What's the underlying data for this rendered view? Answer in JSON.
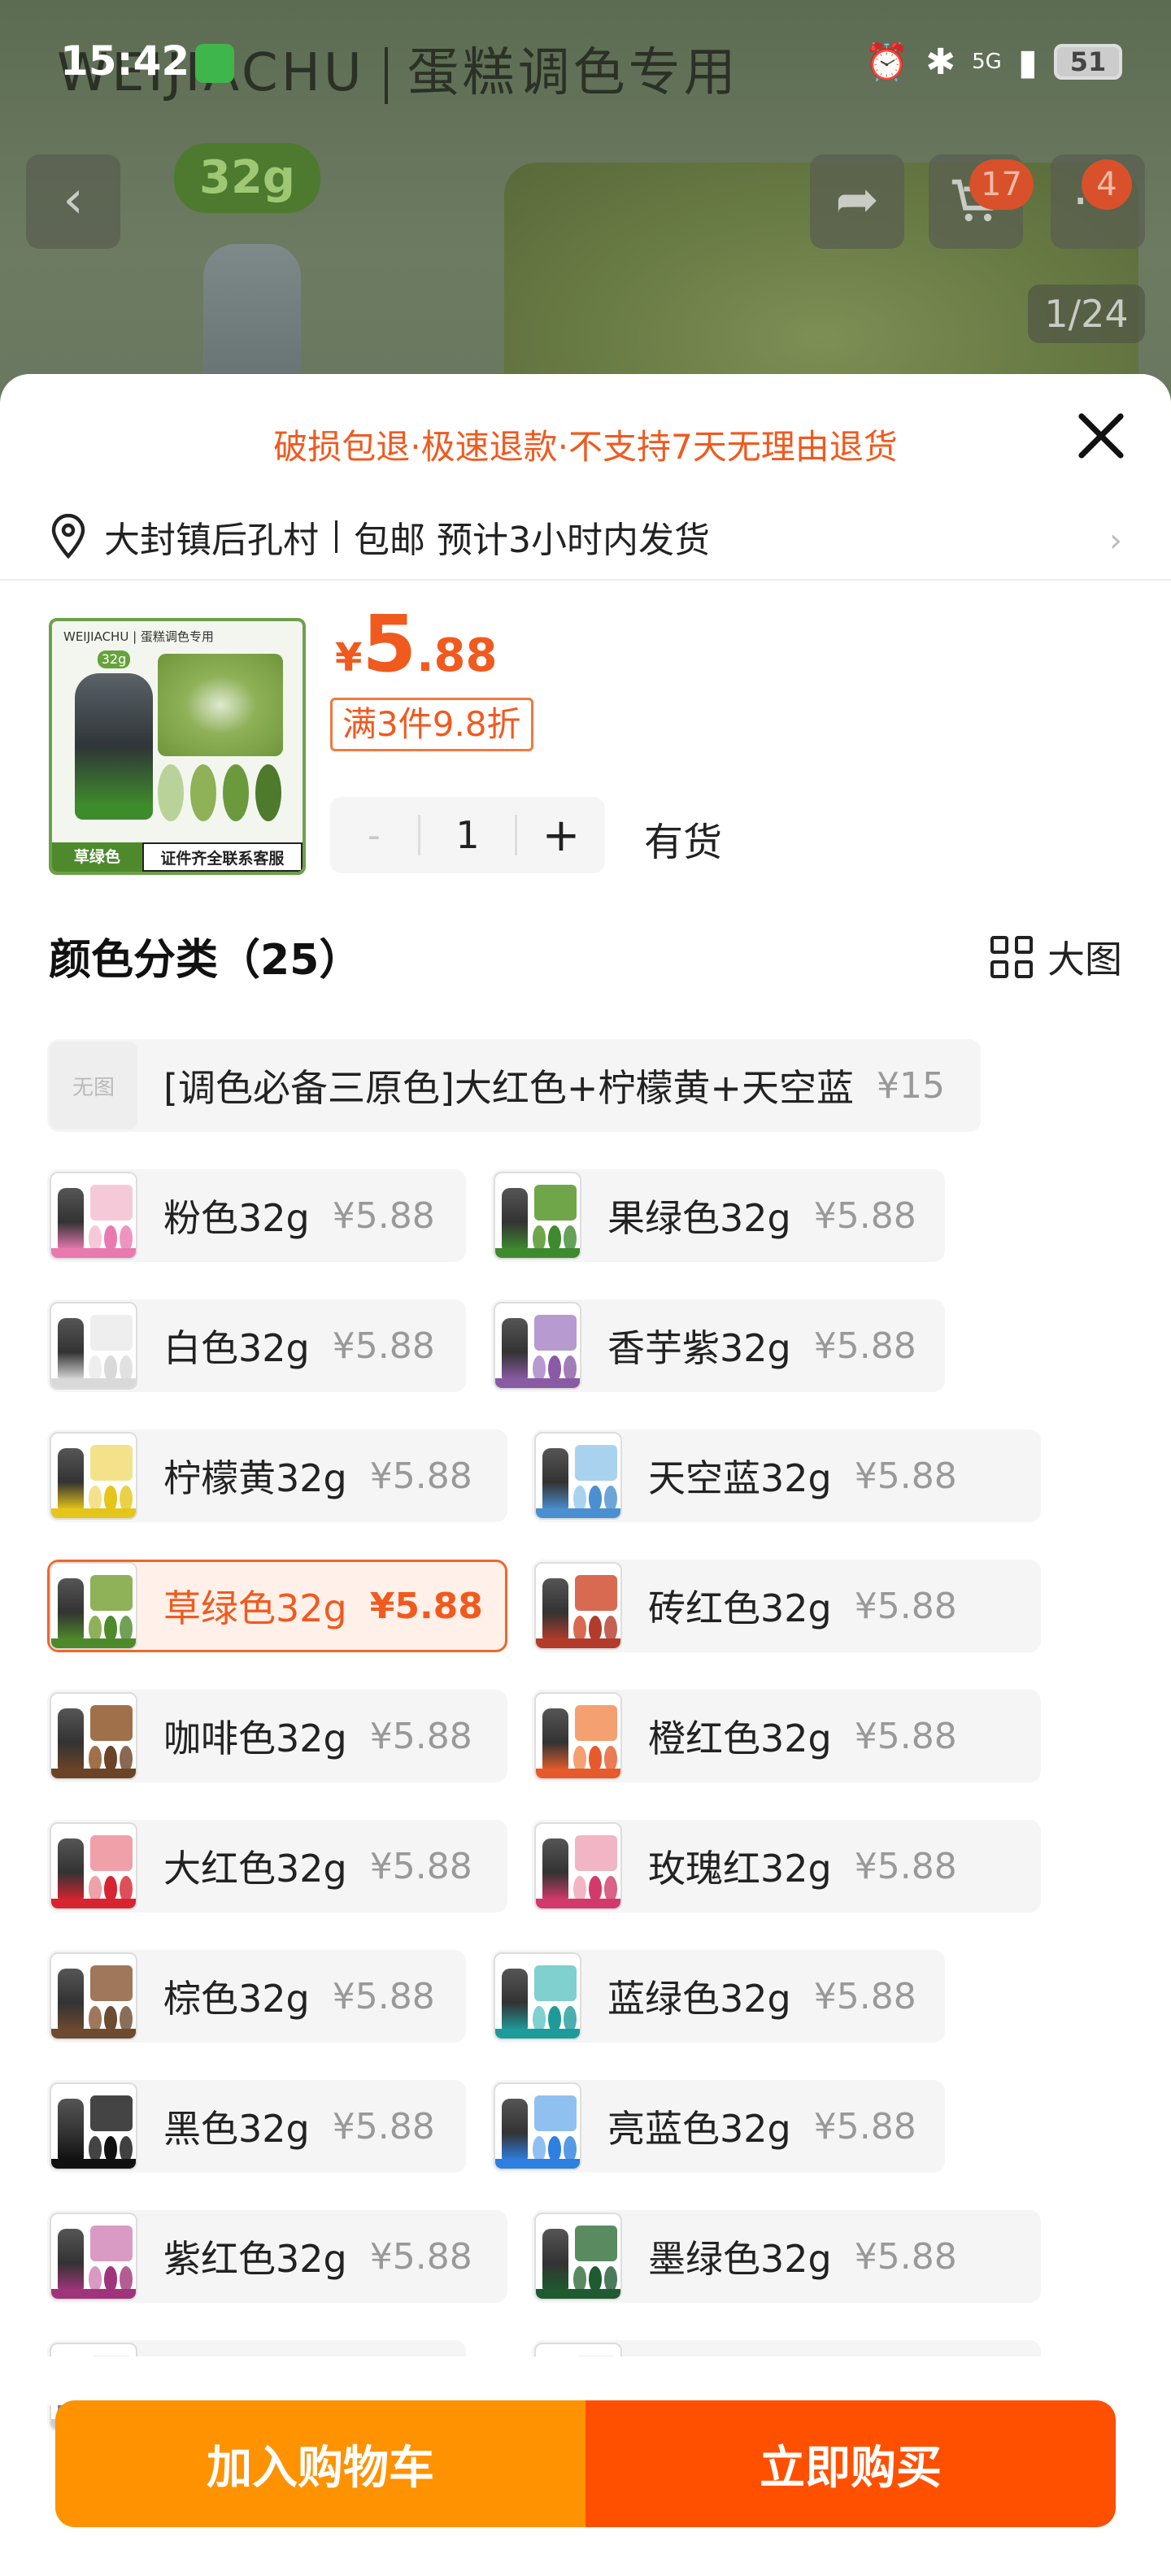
{
  "status": {
    "time": "15:42",
    "battery": "51",
    "network": "5G"
  },
  "background": {
    "brand": "WEIJIACHU",
    "brand_cn": "蛋糕调色专用",
    "size_badge": "32g",
    "cart_count": "17",
    "msg_count": "4",
    "image_counter": "1/24"
  },
  "sheet": {
    "notice": "破损包退·极速退款·不支持7天无理由退货",
    "address": "大封镇后孔村",
    "shipping": "包邮 预计3小时内发货",
    "price_symbol": "¥",
    "price_int": "5",
    "price_dec": ".88",
    "discount": "满3件9.8折",
    "qty": "1",
    "minus": "-",
    "plus": "+",
    "stock": "有货",
    "section_title": "颜色分类（25）",
    "big_view": "大图",
    "thumb": {
      "brand": "WEIJIACHU | 蛋糕调色专用",
      "size": "32g",
      "label": "草绿色",
      "label2": "证件齐全联系客服"
    }
  },
  "options": [
    {
      "name": "[调色必备三原色]大红色+柠檬黄+天空蓝",
      "price": "¥15",
      "noimg": "无图",
      "color": "#cccccc",
      "cake": "#dddddd"
    },
    {
      "name": "粉色32g",
      "price": "¥5.88",
      "color": "#e87ab0",
      "cake": "#f6c9d8"
    },
    {
      "name": "果绿色32g",
      "price": "¥5.88",
      "color": "#3f8a2f",
      "cake": "#6fa64a"
    },
    {
      "name": "白色32g",
      "price": "¥5.88",
      "color": "#d9d9d9",
      "cake": "#eeeeee"
    },
    {
      "name": "香芋紫32g",
      "price": "¥5.88",
      "color": "#8a5ba5",
      "cake": "#b79ad0"
    },
    {
      "name": "柠檬黄32g",
      "price": "¥5.88",
      "color": "#e6c51a",
      "cake": "#f3e28a"
    },
    {
      "name": "天空蓝32g",
      "price": "¥5.88",
      "color": "#4a8fd0",
      "cake": "#a9d2ee"
    },
    {
      "name": "草绿色32g",
      "price": "¥5.88",
      "color": "#4e8a2c",
      "cake": "#8fb158",
      "selected": true
    },
    {
      "name": "砖红色32g",
      "price": "¥5.88",
      "color": "#b33b2b",
      "cake": "#d96a52"
    },
    {
      "name": "咖啡色32g",
      "price": "¥5.88",
      "color": "#6b4327",
      "cake": "#a0704a"
    },
    {
      "name": "橙红色32g",
      "price": "¥5.88",
      "color": "#e55b2b",
      "cake": "#f4a070"
    },
    {
      "name": "大红色32g",
      "price": "¥5.88",
      "color": "#d62430",
      "cake": "#f0a0a8"
    },
    {
      "name": "玫瑰红32g",
      "price": "¥5.88",
      "color": "#d13a6a",
      "cake": "#f2b5c6"
    },
    {
      "name": "棕色32g",
      "price": "¥5.88",
      "color": "#6d4a30",
      "cake": "#a0775a"
    },
    {
      "name": "蓝绿色32g",
      "price": "¥5.88",
      "color": "#1f9a9a",
      "cake": "#7fd0cf"
    },
    {
      "name": "黑色32g",
      "price": "¥5.88",
      "color": "#111111",
      "cake": "#444444"
    },
    {
      "name": "亮蓝色32g",
      "price": "¥5.88",
      "color": "#2e7fe0",
      "cake": "#8fc0f0"
    },
    {
      "name": "紫红色32g",
      "price": "¥5.88",
      "color": "#a0347a",
      "cake": "#d99ac4"
    },
    {
      "name": "墨绿色32g",
      "price": "¥5.88",
      "color": "#1f5a30",
      "cake": "#5a8a60"
    },
    {
      "name": "",
      "price": "",
      "color": "#cccccc",
      "cake": "#eeeeee",
      "partial": true
    },
    {
      "name": "",
      "price": "",
      "color": "#cccccc",
      "cake": "#eeeeee",
      "partial": true
    }
  ],
  "actions": {
    "add_cart": "加入购物车",
    "buy_now": "立即购买"
  }
}
